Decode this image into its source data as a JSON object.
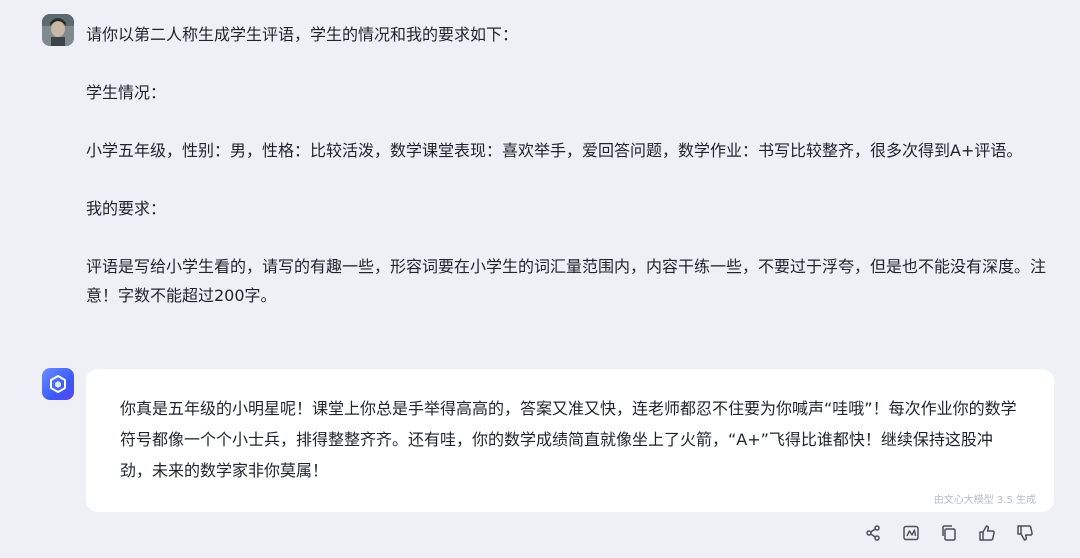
{
  "user": {
    "prompt": "请你以第二人称生成学生评语，学生的情况和我的要求如下：",
    "situation_heading": "学生情况：",
    "situation": "小学五年级，性别：男，性格：比较活泼，数学课堂表现：喜欢举手，爱回答问题，数学作业：书写比较整齐，很多次得到A+评语。",
    "requirement_heading": "我的要求：",
    "requirement": "评语是写给小学生看的，请写的有趣一些，形容词要在小学生的词汇量范围内，内容干练一些，不要过于浮夸，但是也不能没有深度。注意！字数不能超过200字。"
  },
  "bot": {
    "reply": "你真是五年级的小明星呢！课堂上你总是手举得高高的，答案又准又快，连老师都忍不住要为你喊声“哇哦”！每次作业你的数学符号都像一个个小士兵，排得整整齐齐。还有哇，你的数学成绩简直就像坐上了火箭，“A+”飞得比谁都快！继续保持这股冲劲，未来的数学家非你莫属！",
    "watermark": "由文心大模型 3.5 生成"
  },
  "actions": {
    "share_icon": "share-icon",
    "image_icon": "image-icon",
    "copy_icon": "copy-icon",
    "like_icon": "thumbs-up-icon",
    "dislike_icon": "thumbs-down-icon"
  }
}
